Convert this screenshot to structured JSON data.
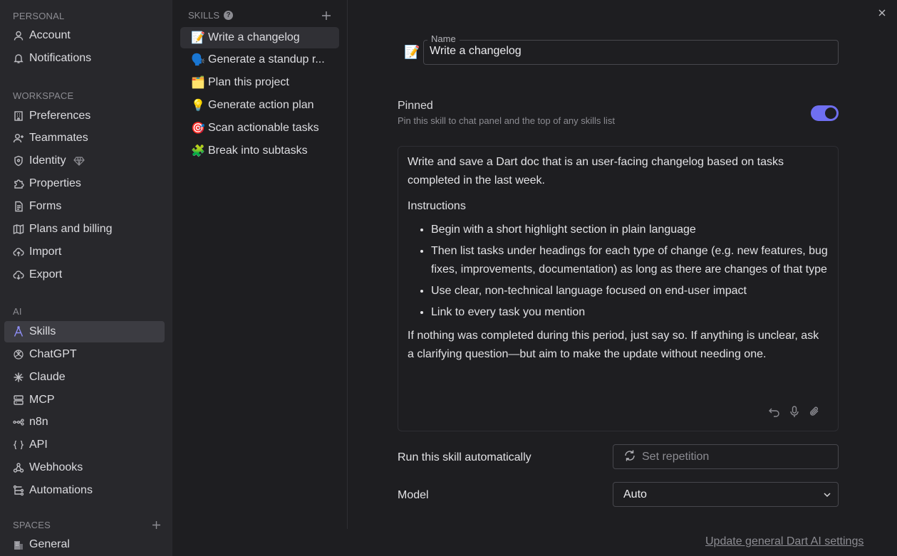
{
  "sidebar": {
    "personal_header": "PERSONAL",
    "personal": [
      {
        "label": "Account",
        "icon": "user-icon"
      },
      {
        "label": "Notifications",
        "icon": "bell-icon"
      }
    ],
    "workspace_header": "WORKSPACE",
    "workspace": [
      {
        "label": "Preferences",
        "icon": "building-icon"
      },
      {
        "label": "Teammates",
        "icon": "user-plus-icon"
      },
      {
        "label": "Identity",
        "icon": "shield-icon"
      },
      {
        "label": "Properties",
        "icon": "puzzle-icon"
      },
      {
        "label": "Forms",
        "icon": "file-icon"
      },
      {
        "label": "Plans and billing",
        "icon": "map-icon"
      },
      {
        "label": "Import",
        "icon": "cloud-upload-icon"
      },
      {
        "label": "Export",
        "icon": "cloud-download-icon"
      }
    ],
    "ai_header": "AI",
    "ai": [
      {
        "label": "Skills",
        "icon": "skills-icon"
      },
      {
        "label": "ChatGPT",
        "icon": "openai-icon"
      },
      {
        "label": "Claude",
        "icon": "claude-icon"
      },
      {
        "label": "MCP",
        "icon": "server-icon"
      },
      {
        "label": "n8n",
        "icon": "n8n-icon"
      },
      {
        "label": "API",
        "icon": "braces-icon"
      },
      {
        "label": "Webhooks",
        "icon": "webhook-icon"
      },
      {
        "label": "Automations",
        "icon": "automation-icon"
      }
    ],
    "spaces_header": "SPACES",
    "spaces": [
      {
        "label": "General",
        "icon": "building-emoji-icon"
      }
    ]
  },
  "skills": {
    "header": "SKILLS",
    "items": [
      {
        "label": "Write a changelog",
        "emoji": "📝"
      },
      {
        "label": "Generate a standup r...",
        "emoji": "🗣️"
      },
      {
        "label": "Plan this project",
        "emoji": "🗂️"
      },
      {
        "label": "Generate action plan",
        "emoji": "💡"
      },
      {
        "label": "Scan actionable tasks",
        "emoji": "🎯"
      },
      {
        "label": "Break into subtasks",
        "emoji": "🧩"
      }
    ]
  },
  "detail": {
    "icon": "📝",
    "name_label": "Name",
    "name_value": "Write a changelog",
    "pinned_title": "Pinned",
    "pinned_desc": "Pin this skill to chat panel and the top of any skills list",
    "pinned_on": true,
    "intro": "Write and save a Dart doc that is an user-facing changelog based on tasks completed in the last week.",
    "instructions_title": "Instructions",
    "bullets": [
      "Begin with a short highlight section in plain language",
      "Then list tasks under headings for each type of change (e.g. new features, bug fixes, improvements, documentation) as long as there are changes of that type",
      "Use clear, non-technical language focused on end-user impact",
      "Link to every task you mention"
    ],
    "outro": "If nothing was completed during this period, just say so. If anything is unclear, ask a clarifying question—but aim to make the update without needing one.",
    "run_label": "Run this skill automatically",
    "repetition_placeholder": "Set repetition",
    "model_label": "Model",
    "model_value": "Auto",
    "footer_link": "Update general Dart AI settings"
  },
  "colors": {
    "accent": "#6f6ff0",
    "sidebar_bg": "#28282c",
    "main_bg": "#1e1e21"
  }
}
